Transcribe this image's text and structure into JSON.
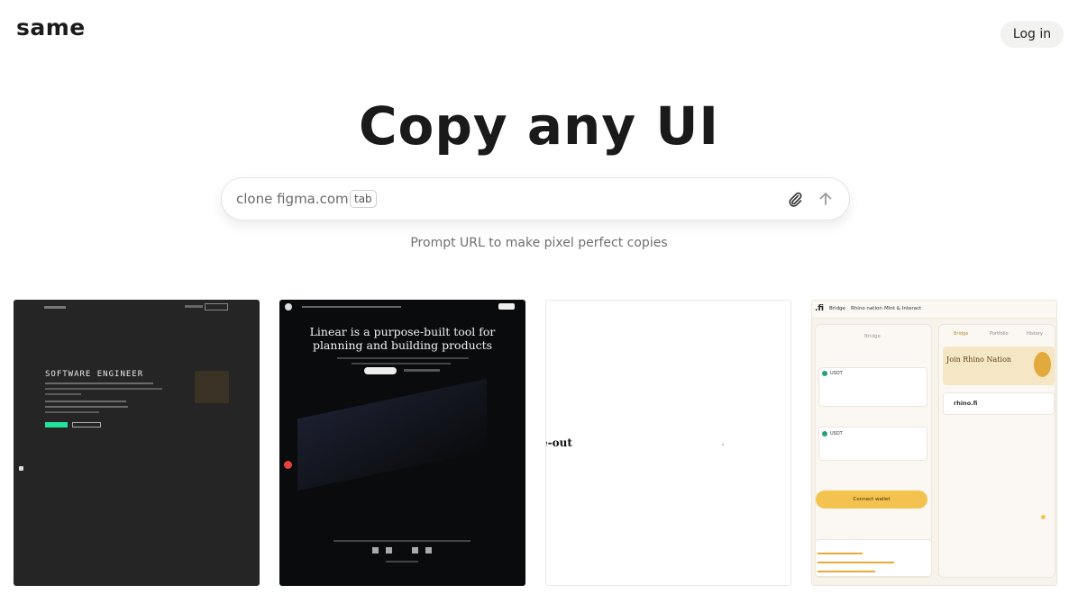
{
  "header": {
    "logo": "same",
    "login_label": "Log in"
  },
  "hero": {
    "title": "Copy any UI"
  },
  "prompt": {
    "placeholder": "clone figma.com",
    "tab_hint": "tab",
    "subtitle": "Prompt URL to make pixel perfect copies"
  },
  "cards": {
    "portfolio": {
      "heading": "SOFTWARE ENGINEER"
    },
    "linear": {
      "headline_line1": "Linear is a purpose-built tool for",
      "headline_line2": "planning and building products"
    },
    "blank": {
      "text": "e-out"
    },
    "rhino": {
      "logo": ".fi",
      "nav": [
        "Bridge",
        "Rhino nation",
        "Mint & Interact"
      ],
      "tabs": [
        "Bridge",
        "Portfolio",
        "History"
      ],
      "join_title": "Join Rhino Nation",
      "brand": "rhino.fi",
      "connect_label": "Connect wallet",
      "tokens": [
        "USDT",
        "USDT"
      ]
    }
  },
  "colors": {
    "accent_green": "#22e39a",
    "rhino_yellow": "#f4c24e",
    "linear_red": "#e0443a"
  }
}
